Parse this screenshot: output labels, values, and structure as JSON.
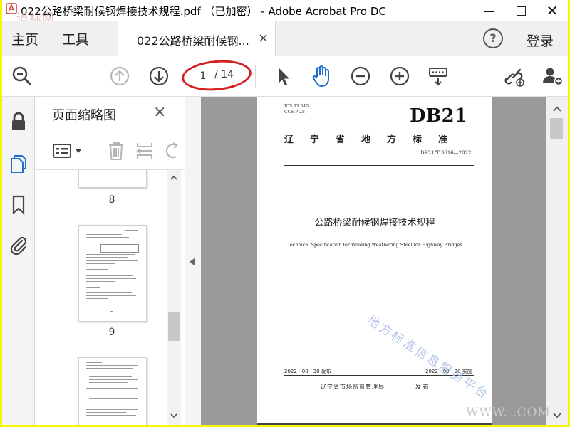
{
  "window": {
    "title": "022公路桥梁耐候钢焊接技术规程.pdf （已加密） - Adobe Acrobat Pro DC",
    "logo_watermark": "道标网",
    "controls": [
      "minimize-icon",
      "maximize-icon",
      "close-icon"
    ]
  },
  "tabs": {
    "home": "主页",
    "tools": "工具",
    "document": "022公路桥梁耐候钢...",
    "document_close": "×",
    "help": "?",
    "login": "登录"
  },
  "toolbar": {
    "page_current": "1",
    "page_total": "/ 14",
    "icons": [
      "zoom-search-icon",
      "page-up-icon",
      "page-down-icon",
      "select-cursor-icon",
      "hand-tool-icon",
      "zoom-out-icon",
      "zoom-in-icon",
      "keyboard-icon",
      "share-link-icon",
      "add-user-icon"
    ],
    "accent_color": "#1e6fcf",
    "annotation_color": "#d62020"
  },
  "rail": {
    "icons": [
      "lock-icon",
      "pages-icon",
      "bookmark-icon",
      "attachment-icon"
    ]
  },
  "thumbnails": {
    "title": "页面缩略图",
    "close": "×",
    "items": [
      {
        "num": "8"
      },
      {
        "num": "9"
      }
    ]
  },
  "document": {
    "codes_line1": "ICS 93.040",
    "codes_line2": "CCS P 28",
    "big_code": "DB21",
    "province_standard": "辽宁省地方标准",
    "std_number": "DB21/T 3616—2022",
    "title_cn": "公路桥梁耐候钢焊接技术规程",
    "title_en": "Technical Specification for Welding Weathering Steel for Highway Bridges",
    "release_date": "2022 - 08 - 30 发布",
    "implement_date": "2022 - 09 - 30 实施",
    "issuer": "辽宁省市场监督管理局",
    "issued": "发 布",
    "watermark": "地方标准信息服务平台",
    "watermark_www": "WWW.          .COM"
  }
}
